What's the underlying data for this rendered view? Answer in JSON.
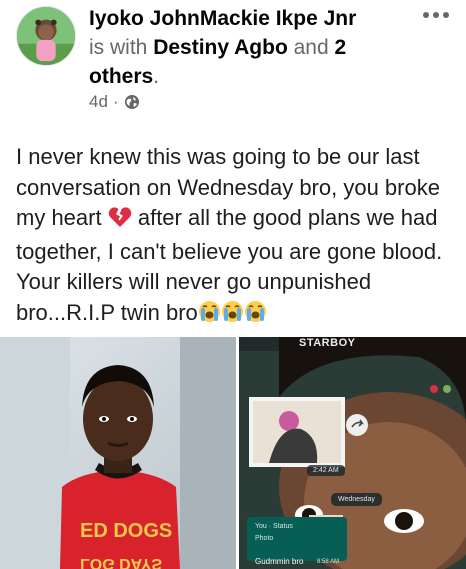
{
  "post": {
    "author": "Iyoko JohnMackie Ikpe Jnr",
    "with_text": "is with",
    "tagged_person": "Destiny Agbo",
    "and_text": "and",
    "others": "2 others",
    "period": ".",
    "timestamp": "4d",
    "separator": "·",
    "privacy_icon": "globe-icon",
    "more_icon": "more-options-icon",
    "text_part1": "I never knew this was going to be our last conversation on Wednesday bro, you broke my heart",
    "text_part2": "after all the good plans we had together, I can't believe you are gone blood. Your killers will never go unpunished bro...R.I.P twin bro",
    "emoji_broken_heart": "broken-heart-icon",
    "emoji_crying": "loudly-crying-face-icon"
  },
  "photos": {
    "left": {
      "shirt_text": "ED DOGS / LOG DAYS"
    },
    "right": {
      "chat_title": "STARBOY",
      "time_label": "2:42 AM",
      "date_label": "Wednesday",
      "status_from": "You · Status",
      "status_photo": "Photo",
      "message": "Gudmmin bro",
      "message_time": "8:58 AM"
    }
  },
  "colors": {
    "text": "#1c1e21",
    "secondary": "#65676b",
    "whatsapp_green": "#075e54"
  }
}
